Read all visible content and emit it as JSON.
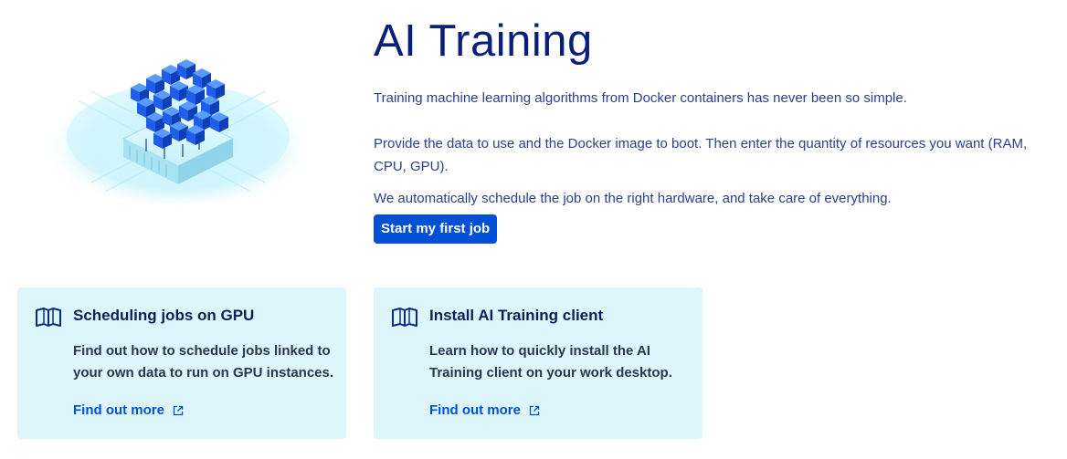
{
  "hero": {
    "title": "AI Training",
    "paragraphs": [
      "Training machine learning algorithms from Docker containers has never been so simple.",
      "Provide the data to use and the Docker image to boot. Then enter the quantity of resources you want (RAM, CPU, GPU).",
      "We automatically schedule the job on the right hardware, and take care of everything."
    ],
    "cta_label": "Start my first job"
  },
  "cards": [
    {
      "title": "Scheduling jobs on GPU",
      "description": "Find out how to schedule jobs linked to your own data to run on GPU instances.",
      "link_label": "Find out more",
      "icon": "book-open-icon"
    },
    {
      "title": "Install AI Training client",
      "description": "Learn how to quickly install the AI Training client on your work desktop.",
      "link_label": "Find out more",
      "icon": "book-open-icon"
    }
  ],
  "colors": {
    "title": "#0a1f7a",
    "text": "#2a3f8f",
    "accent": "#0050d7",
    "card_bg": "#ddf6fc"
  }
}
